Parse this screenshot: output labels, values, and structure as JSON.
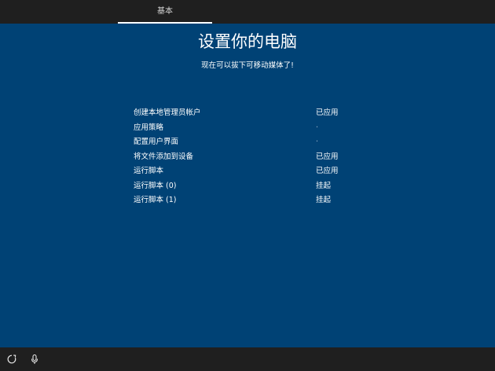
{
  "top_bar": {
    "tab_label": "基本"
  },
  "main": {
    "title": "设置你的电脑",
    "subtitle": "现在可以拔下可移动媒体了!",
    "tasks": [
      {
        "label": "创建本地管理员帐户",
        "status": "已应用"
      },
      {
        "label": "应用策略",
        "status": "·"
      },
      {
        "label": "配置用户界面",
        "status": "·"
      },
      {
        "label": "将文件添加到设备",
        "status": "已应用"
      },
      {
        "label": "运行脚本",
        "status": "已应用"
      },
      {
        "label": "运行脚本 (0)",
        "status": "挂起"
      },
      {
        "label": "运行脚本 (1)",
        "status": "挂起"
      }
    ]
  },
  "bottom_bar": {
    "icons": [
      "ease-of-access-icon",
      "microphone-icon"
    ]
  },
  "colors": {
    "background": "#004275",
    "bar": "#1f1f1f",
    "text": "#ffffff"
  }
}
